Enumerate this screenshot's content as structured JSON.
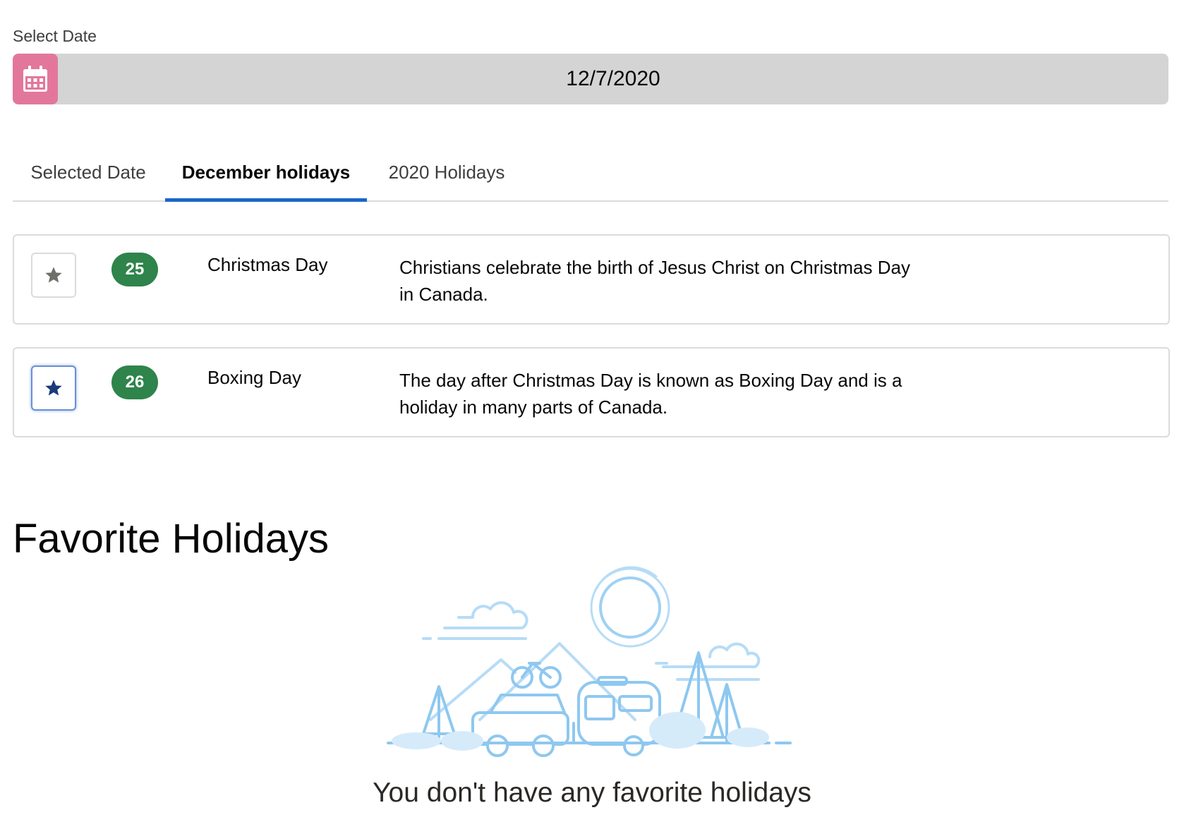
{
  "date_picker": {
    "label": "Select Date",
    "icon": "calendar-icon",
    "value": "12/7/2020"
  },
  "tabs": [
    {
      "label": "Selected Date",
      "active": false
    },
    {
      "label": "December holidays",
      "active": true
    },
    {
      "label": "2020 Holidays",
      "active": false
    }
  ],
  "holidays": [
    {
      "day": "25",
      "name": "Christmas Day",
      "description_line1": "Christians celebrate the birth of Jesus Christ on Christmas Day",
      "description_line2": "in Canada.",
      "favorite": false
    },
    {
      "day": "26",
      "name": "Boxing Day",
      "description_line1": "The day after Christmas Day is known as Boxing Day and is a",
      "description_line2": "holiday in many parts of Canada.",
      "favorite": true
    }
  ],
  "favorites": {
    "title": "Favorite Holidays",
    "empty_message": "You don't have any favorite holidays",
    "illustration": "camping-illustration"
  },
  "colors": {
    "calendar_icon_bg": "#e3779b",
    "active_tab_underline": "#1b66c9",
    "day_badge": "#2e844a",
    "star_inactive": "#706e6b",
    "star_active": "#1b3a7a",
    "illustration_stroke": "#8ec8f0"
  }
}
